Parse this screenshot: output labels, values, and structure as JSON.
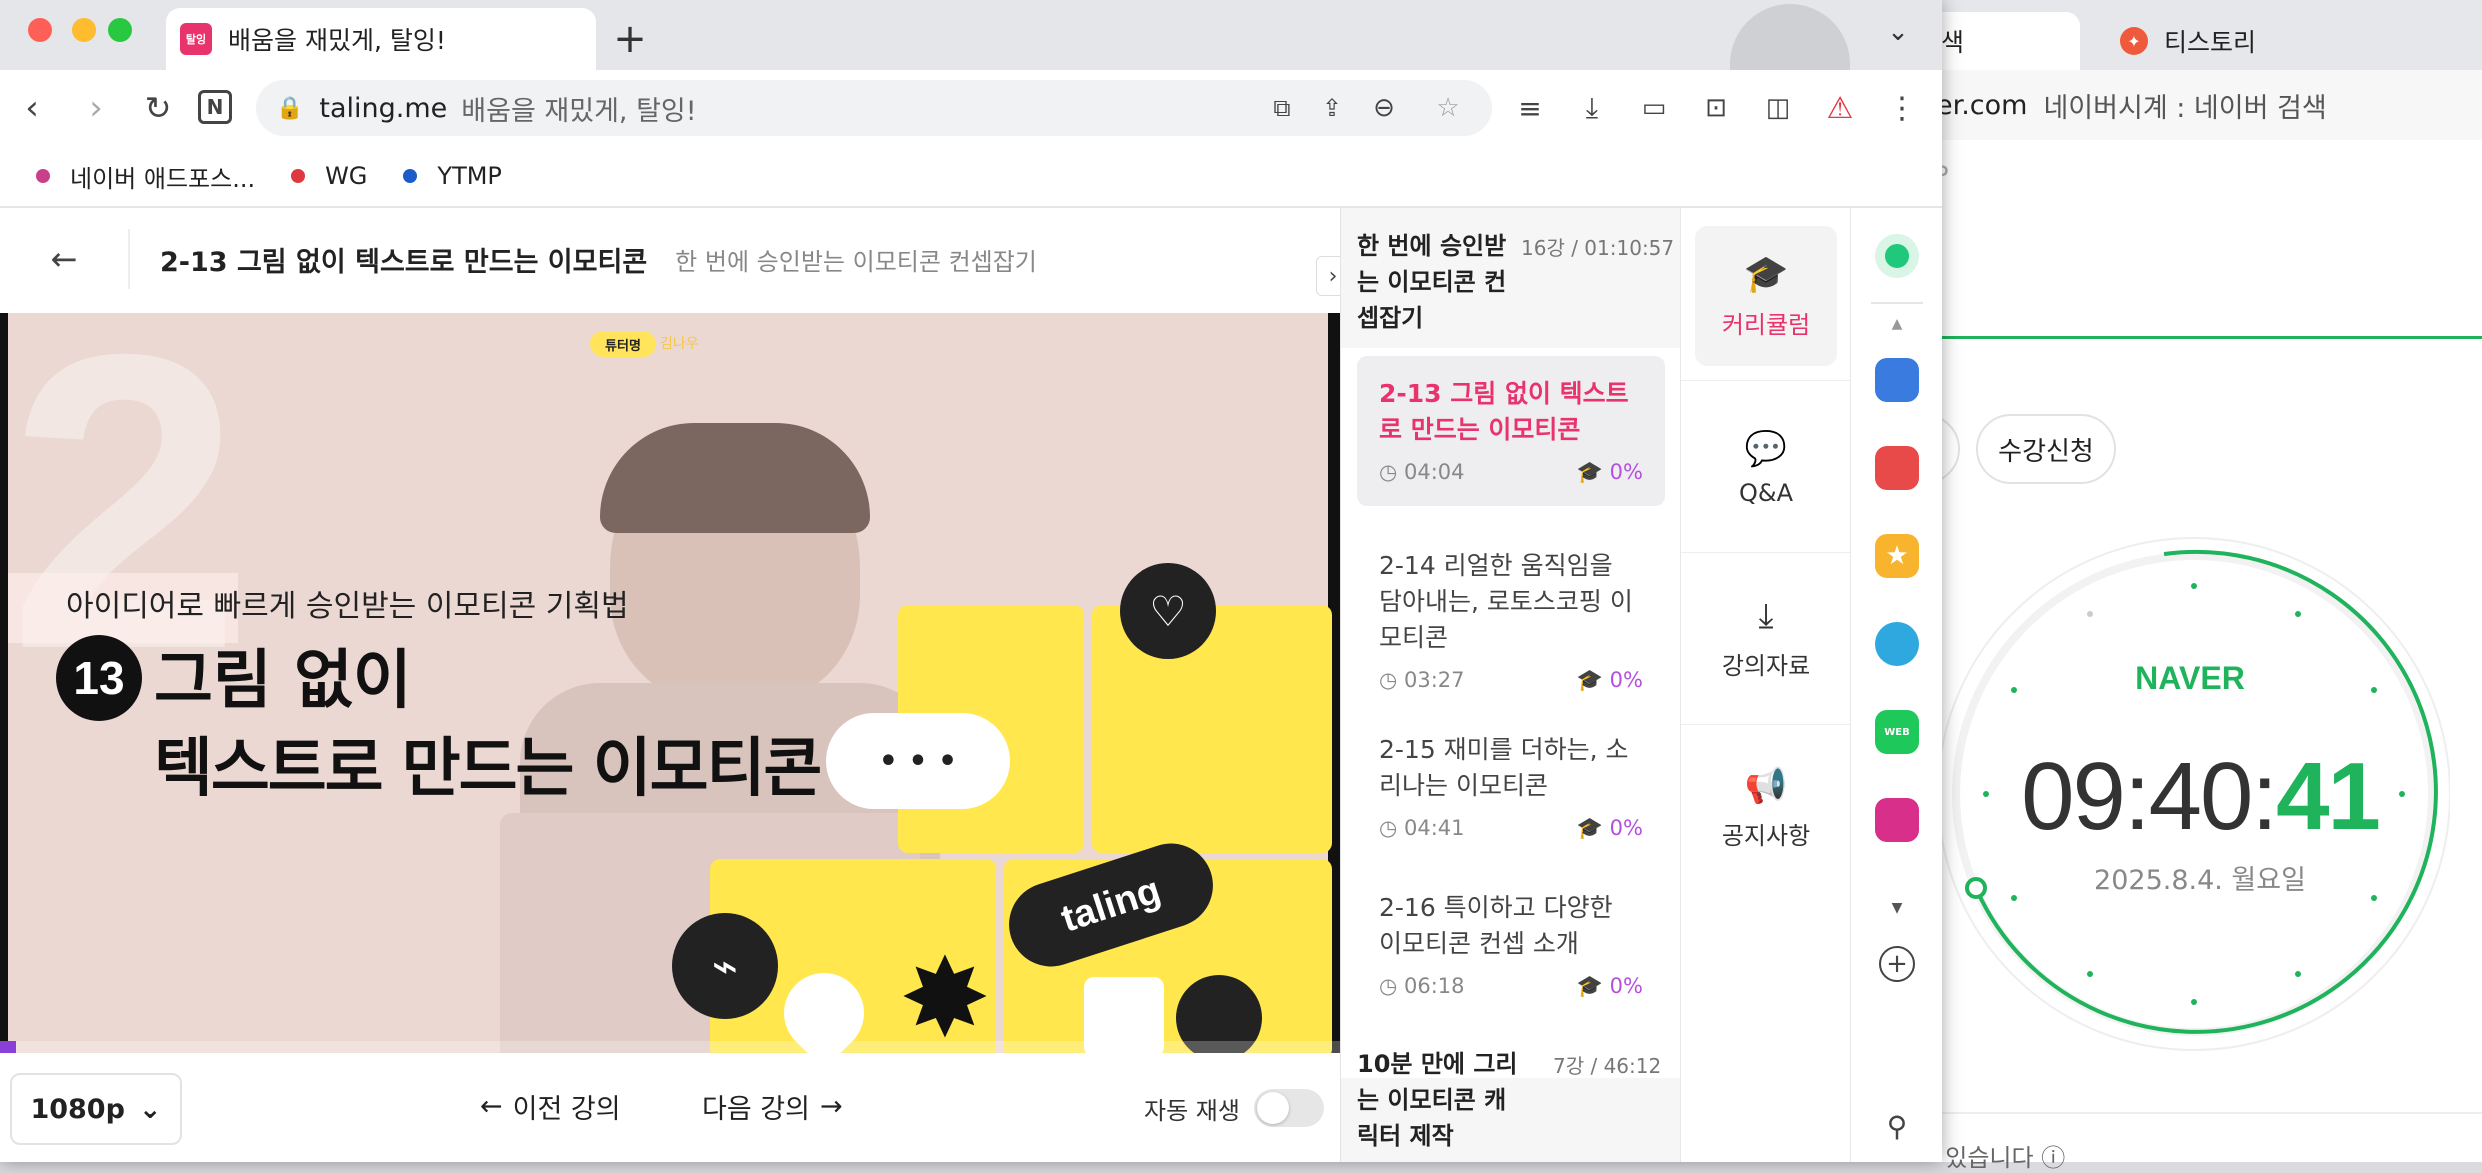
{
  "browser": {
    "active_tab": {
      "favicon": "탈잉",
      "title": "배움을 재밌게, 탈잉!"
    },
    "new_tab": "+",
    "url_domain": "taling.me",
    "url_title": "배움을 재밌게, 탈잉!"
  },
  "bookmarks": [
    {
      "label": "네이버 애드포스...",
      "color": "#c8408a"
    },
    {
      "label": "WG",
      "color": "#e0383f"
    },
    {
      "label": "YTMP",
      "color": "#1a5cc8"
    }
  ],
  "background_window": {
    "tab1": "검색",
    "tab2": "티스토리",
    "url_domain": "ver.com",
    "url_title": "네이버시계 : 네이버 검색",
    "bookmark": "P",
    "chip": "수강신청",
    "brand": "NAVER",
    "time_hm": "09:40:",
    "time_s": "41",
    "date": "2025.8.4. 월요일",
    "bottom": "· 있습니다 ⓘ"
  },
  "header": {
    "lesson_title": "2-13 그림 없이 텍스트로 만드는 이모티콘",
    "course_title": "한 번에 승인받는 이모티콘 컨셉잡기"
  },
  "video": {
    "badge": "튜터명",
    "badge_sub": "김나우",
    "big_number": "2",
    "subtitle": "아이디어로 빠르게 승인받는 이모티콘 기획법",
    "number": "13",
    "title_line1": "그림 없이",
    "title_line2": "텍스트로 만드는 이모티콘",
    "dots": "• • •",
    "sticker": "taling"
  },
  "controls": {
    "quality": "1080p",
    "prev": "이전 강의",
    "next": "다음 강의",
    "autoplay_label": "자동 재생"
  },
  "playlist": {
    "section1": {
      "title": "한 번에 승인받는 이모티콘 컨셉잡기",
      "meta": "16강 / 01:10:57"
    },
    "lectures": [
      {
        "title": "2-13 그림 없이 텍스트로 만드는 이모티콘",
        "duration": "04:04",
        "progress": "0%"
      },
      {
        "title": "2-14 리얼한 움직임을 담아내는, 로토스코핑 이모티콘",
        "duration": "03:27",
        "progress": "0%"
      },
      {
        "title": "2-15 재미를 더하는, 소리나는 이모티콘",
        "duration": "04:41",
        "progress": "0%"
      },
      {
        "title": "2-16 특이하고 다양한 이모티콘 컨셉 소개",
        "duration": "06:18",
        "progress": "0%"
      }
    ],
    "section2": {
      "title": "10분 만에 그리는 이모티콘 캐릭터 제작",
      "meta": "7강 / 46:12"
    }
  },
  "sidetabs": [
    {
      "label": "커리큘럼",
      "icon": "graduation-cap-icon"
    },
    {
      "label": "Q&A",
      "icon": "chat-bubble-icon"
    },
    {
      "label": "강의자료",
      "icon": "download-icon"
    },
    {
      "label": "공지사항",
      "icon": "megaphone-icon"
    }
  ],
  "colors": {
    "accent": "#e8336d",
    "naver_green": "#1fb35c",
    "progress": "#b450e0"
  }
}
